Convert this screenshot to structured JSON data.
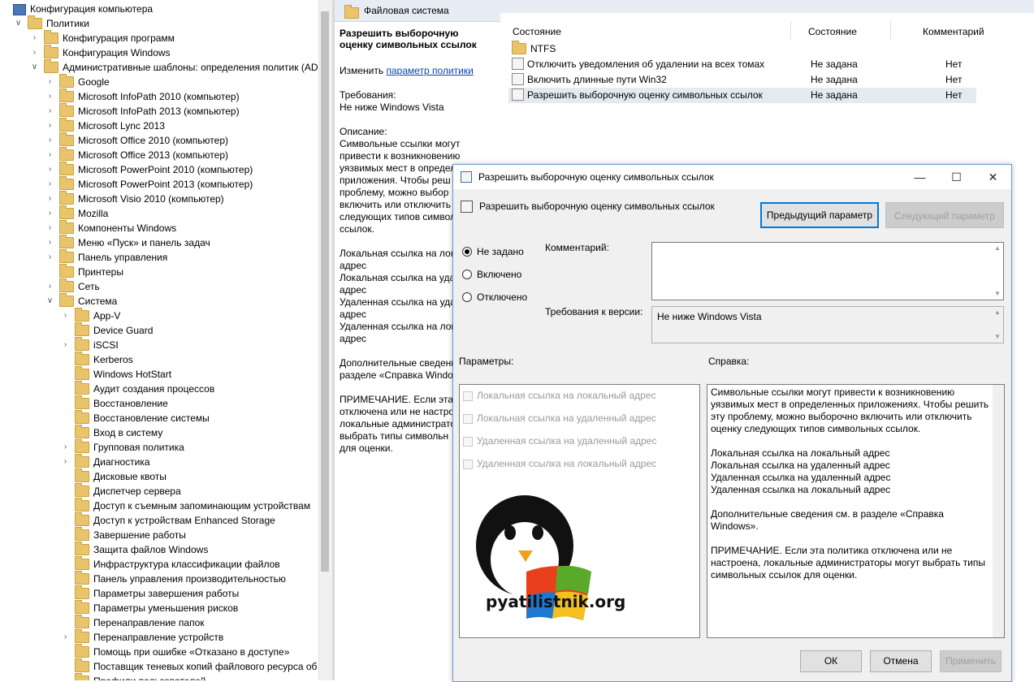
{
  "tree": {
    "root": "Конфигурация компьютера",
    "rows": [
      {
        "label": "Политики",
        "indent": 1,
        "chev": "v"
      },
      {
        "label": "Конфигурация программ",
        "indent": 2,
        "chev": ">"
      },
      {
        "label": "Конфигурация Windows",
        "indent": 2,
        "chev": ">"
      },
      {
        "label": "Административные шаблоны: определения политик (AD",
        "indent": 2,
        "chev": "v"
      },
      {
        "label": "Google",
        "indent": 3,
        "chev": ">"
      },
      {
        "label": "Microsoft InfoPath 2010 (компьютер)",
        "indent": 3,
        "chev": ">"
      },
      {
        "label": "Microsoft InfoPath 2013 (компьютер)",
        "indent": 3,
        "chev": ">"
      },
      {
        "label": "Microsoft Lync 2013",
        "indent": 3,
        "chev": ">"
      },
      {
        "label": "Microsoft Office 2010 (компьютер)",
        "indent": 3,
        "chev": ">"
      },
      {
        "label": "Microsoft Office 2013 (компьютер)",
        "indent": 3,
        "chev": ">"
      },
      {
        "label": "Microsoft PowerPoint 2010 (компьютер)",
        "indent": 3,
        "chev": ">"
      },
      {
        "label": "Microsoft PowerPoint 2013 (компьютер)",
        "indent": 3,
        "chev": ">"
      },
      {
        "label": "Microsoft Visio 2010 (компьютер)",
        "indent": 3,
        "chev": ">"
      },
      {
        "label": "Mozilla",
        "indent": 3,
        "chev": ">"
      },
      {
        "label": "Компоненты Windows",
        "indent": 3,
        "chev": ">"
      },
      {
        "label": "Меню «Пуск» и панель задач",
        "indent": 3,
        "chev": ">"
      },
      {
        "label": "Панель управления",
        "indent": 3,
        "chev": ">"
      },
      {
        "label": "Принтеры",
        "indent": 3,
        "chev": ""
      },
      {
        "label": "Сеть",
        "indent": 3,
        "chev": ">"
      },
      {
        "label": "Система",
        "indent": 3,
        "chev": "v"
      },
      {
        "label": "App-V",
        "indent": 4,
        "chev": ">"
      },
      {
        "label": "Device Guard",
        "indent": 4,
        "chev": ""
      },
      {
        "label": "iSCSI",
        "indent": 4,
        "chev": ">"
      },
      {
        "label": "Kerberos",
        "indent": 4,
        "chev": ""
      },
      {
        "label": "Windows HotStart",
        "indent": 4,
        "chev": ""
      },
      {
        "label": "Аудит создания процессов",
        "indent": 4,
        "chev": ""
      },
      {
        "label": "Восстановление",
        "indent": 4,
        "chev": ""
      },
      {
        "label": "Восстановление системы",
        "indent": 4,
        "chev": ""
      },
      {
        "label": "Вход в систему",
        "indent": 4,
        "chev": ""
      },
      {
        "label": "Групповая политика",
        "indent": 4,
        "chev": ">"
      },
      {
        "label": "Диагностика",
        "indent": 4,
        "chev": ">"
      },
      {
        "label": "Дисковые квоты",
        "indent": 4,
        "chev": ""
      },
      {
        "label": "Диспетчер сервера",
        "indent": 4,
        "chev": ""
      },
      {
        "label": "Доступ к съемным запоминающим устройствам",
        "indent": 4,
        "chev": ""
      },
      {
        "label": "Доступ к устройствам Enhanced Storage",
        "indent": 4,
        "chev": ""
      },
      {
        "label": "Завершение работы",
        "indent": 4,
        "chev": ""
      },
      {
        "label": "Защита файлов Windows",
        "indent": 4,
        "chev": ""
      },
      {
        "label": "Инфраструктура классификации файлов",
        "indent": 4,
        "chev": ""
      },
      {
        "label": "Панель управления производительностью",
        "indent": 4,
        "chev": ""
      },
      {
        "label": "Параметры завершения работы",
        "indent": 4,
        "chev": ""
      },
      {
        "label": "Параметры уменьшения рисков",
        "indent": 4,
        "chev": ""
      },
      {
        "label": "Перенаправление папок",
        "indent": 4,
        "chev": ""
      },
      {
        "label": "Перенаправление устройств",
        "indent": 4,
        "chev": ">"
      },
      {
        "label": "Помощь при ошибке «Отказано в доступе»",
        "indent": 4,
        "chev": ""
      },
      {
        "label": "Поставщик теневых копий файлового ресурса об",
        "indent": 4,
        "chev": ""
      },
      {
        "label": "Профили пользователей",
        "indent": 4,
        "chev": ""
      }
    ]
  },
  "pane": {
    "header": "Файловая система",
    "desc_title": "Разрешить выборочную оценку символьных ссылок",
    "edit_prefix": "Изменить",
    "edit_link": "параметр политики",
    "req_label": "Требования:",
    "req_value": "Не ниже Windows Vista",
    "desc_label": "Описание:",
    "desc_lines": [
      "Символьные ссылки могут",
      "привести к возникновению",
      "уязвимых мест в определ",
      "приложения. Чтобы реш",
      "проблему, можно выбор",
      "включить или отключить",
      "следующих типов символ",
      "ссылок.",
      "",
      "Локальная ссылка на лока",
      "адрес",
      "Локальная ссылка на уда",
      "адрес",
      "Удаленная ссылка на уда",
      "адрес",
      "Удаленная ссылка на лок",
      "адрес",
      "",
      "Дополнительные сведени",
      "разделе «Справка Windov",
      "",
      "ПРИМЕЧАНИЕ. Если эта",
      "отключена или не настро",
      "локальные администрато",
      "выбрать типы символьн",
      "для оценки."
    ],
    "columns": [
      "Состояние",
      "Состояние",
      "Комментарий"
    ],
    "rows": [
      {
        "name": "NTFS",
        "state": "",
        "comment": "",
        "icon": "folder-icon"
      },
      {
        "name": "Отключить уведомления об удалении на всех томах",
        "state": "Не задана",
        "comment": "Нет",
        "icon": "policy-setting-icon"
      },
      {
        "name": "Включить длинные пути Win32",
        "state": "Не задана",
        "comment": "Нет",
        "icon": "policy-setting-icon"
      },
      {
        "name": "Разрешить выборочную оценку символьных ссылок",
        "state": "Не задана",
        "comment": "Нет",
        "icon": "policy-setting-icon"
      }
    ]
  },
  "dialog": {
    "title": "Разрешить выборочную оценку символьных ссылок",
    "subtitle": "Разрешить выборочную оценку символьных ссылок",
    "prev_button": "Предыдущий параметр",
    "next_button": "Следующий параметр",
    "radio_not_set": "Не задано",
    "radio_enabled": "Включено",
    "radio_disabled": "Отключено",
    "comment_label": "Комментарий:",
    "comment_value": "",
    "version_label": "Требования к версии:",
    "version_value": "Не ниже Windows Vista",
    "params_label": "Параметры:",
    "help_label": "Справка:",
    "params": [
      "Локальная ссылка на локальный адрес",
      "Локальная ссылка на удаленный адрес",
      "Удаленная ссылка на удаленный адрес",
      "Удаленная ссылка на локальный адрес"
    ],
    "help_text": "Символьные ссылки могут привести к возникновению\nуязвимых мест в определенных приложениях. Чтобы решить\nэту проблему, можно выборочно включить или отключить\nоценку следующих типов символьных ссылок.\n\nЛокальная ссылка на локальный адрес\nЛокальная ссылка на удаленный адрес\nУдаленная ссылка на удаленный адрес\nУдаленная ссылка на локальный адрес\n\nДополнительные сведения см. в разделе «Справка Windows».\n\nПРИМЕЧАНИЕ. Если эта политика отключена или не\nнастроена, локальные администраторы могут выбрать типы\nсимвольных ссылок для оценки.",
    "ok_button": "ОК",
    "cancel_button": "Отмена",
    "apply_button": "Применить",
    "watermark_text": "pyatilistnik.org"
  }
}
